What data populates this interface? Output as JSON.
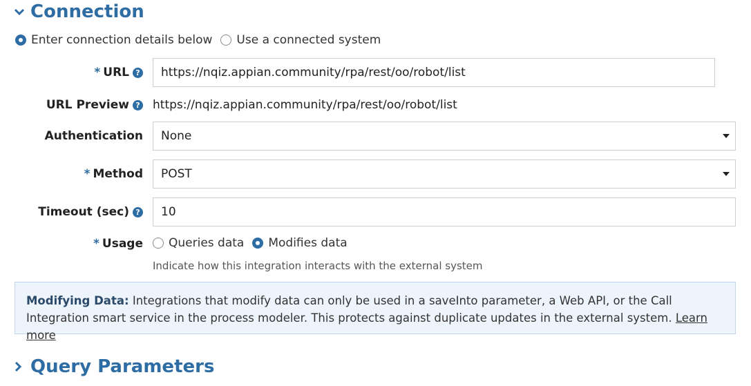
{
  "connection": {
    "title": "Connection",
    "radio_details_label": "Enter connection details below",
    "radio_system_label": "Use a connected system"
  },
  "url": {
    "label": "URL",
    "value": "https://nqiz.appian.community/rpa/rest/oo/robot/list"
  },
  "url_preview": {
    "label": "URL Preview",
    "value": "https://nqiz.appian.community/rpa/rest/oo/robot/list"
  },
  "authentication": {
    "label": "Authentication",
    "value": "None"
  },
  "method": {
    "label": "Method",
    "value": "POST"
  },
  "timeout": {
    "label": "Timeout (sec)",
    "value": "10"
  },
  "usage": {
    "label": "Usage",
    "option_queries": "Queries data",
    "option_modifies": "Modifies data",
    "hint": "Indicate how this integration interacts with the external system"
  },
  "info_box": {
    "title": "Modifying Data:",
    "text": "Integrations that modify data can only be used in a saveInto parameter, a Web API, or the Call Integration smart service in the process modeler. This protects against duplicate updates in the external system.",
    "link": "Learn more"
  },
  "query_parameters": {
    "title": "Query Parameters"
  },
  "symbols": {
    "required": "*",
    "help": "?"
  },
  "colors": {
    "accent": "#2e6ca4",
    "info_bg": "#eef4fb"
  }
}
